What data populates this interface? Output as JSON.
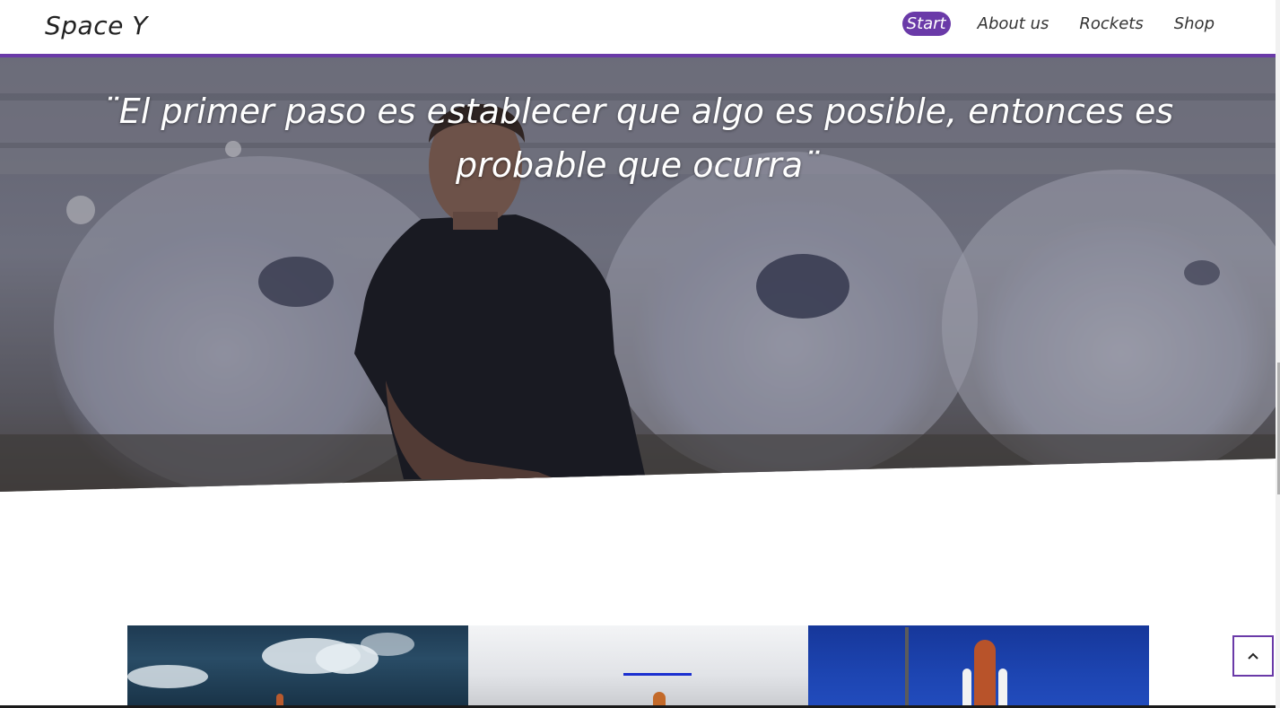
{
  "header": {
    "brand": "Space Y",
    "nav": [
      "Start",
      "About us",
      "Rockets",
      "Shop"
    ],
    "active_nav": "Start"
  },
  "hero": {
    "quote_line1": "¨El primer paso es establecer que algo es posible, entonces es",
    "quote_line2": "probable que ocurra¨"
  },
  "colors": {
    "accent": "#6a3aa8",
    "divider_blue": "#1b2fd0"
  },
  "back_to_top": {
    "icon": "chevron-up-icon"
  }
}
